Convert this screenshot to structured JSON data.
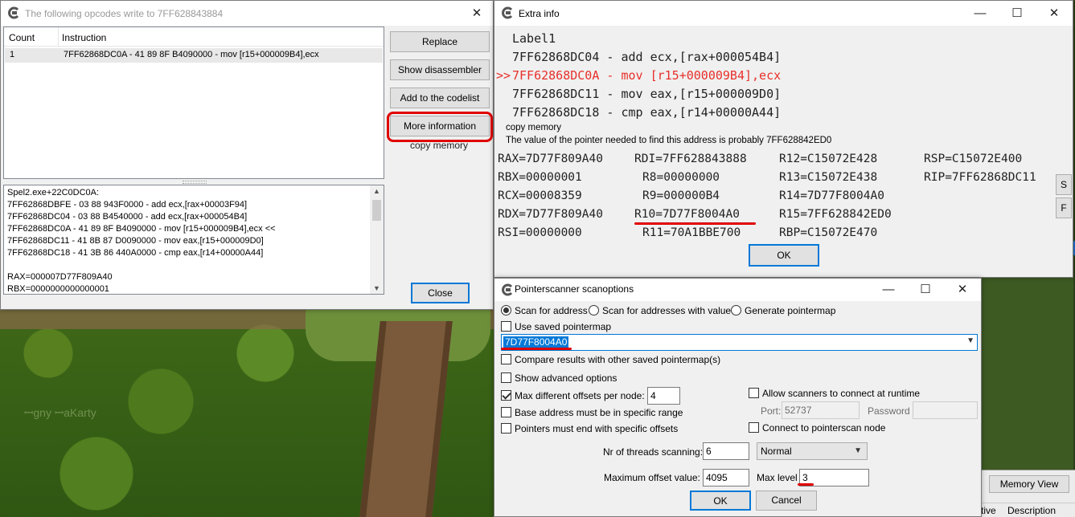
{
  "background": {
    "blur_text": "ꟷgny ꟷaKarty",
    "memory_view_label": "Memory View",
    "columns": [
      "ctive",
      "Description"
    ]
  },
  "opcodes_window": {
    "title": "The following opcodes write to 7FF628843884",
    "columns": [
      "Count",
      "Instruction"
    ],
    "rows": [
      {
        "count": "1",
        "instruction": "7FF62868DC0A - 41 89 8F B4090000  - mov [r15+000009B4],ecx"
      }
    ],
    "buttons": {
      "replace": "Replace",
      "show_disassembler": "Show disassembler",
      "add_codelist": "Add to the codelist",
      "more_information": "More information",
      "close": "Close"
    },
    "copy_memory_label": "copy memory",
    "memo_lines": [
      "Spel2.exe+22C0DC0A:",
      "7FF62868DBFE - 03 88 943F0000  - add ecx,[rax+00003F94]",
      "7FF62868DC04 - 03 88 B4540000  - add ecx,[rax+000054B4]",
      "7FF62868DC0A - 41 89 8F B4090000  - mov [r15+000009B4],ecx <<",
      "7FF62868DC11 - 41 8B 87 D0090000  - mov eax,[r15+000009D0]",
      "7FF62868DC18 - 41 3B 86 440A0000  - cmp eax,[r14+00000A44]",
      "",
      "RAX=000007D77F809A40",
      "RBX=0000000000000001"
    ]
  },
  "extra_info_window": {
    "title": "Extra info",
    "label": "Label1",
    "code_lines": [
      {
        "prefix": "",
        "text": "7FF62868DC04 - add ecx,[rax+000054B4]",
        "current": false
      },
      {
        "prefix": ">>",
        "text": "7FF62868DC0A - mov [r15+000009B4],ecx",
        "current": true
      },
      {
        "prefix": "",
        "text": "7FF62868DC11 - mov eax,[r15+000009D0]",
        "current": false
      },
      {
        "prefix": "",
        "text": "7FF62868DC18 - cmp eax,[r14+00000A44]",
        "current": false
      }
    ],
    "copy_memory": "copy memory",
    "pointer_note": "The value of the pointer needed to find this address is probably 7FF628842ED0",
    "registers": [
      [
        "RAX=7D77F809A40",
        "RDI=7FF628843888",
        "R12=C15072E428",
        "RSP=C15072E400"
      ],
      [
        "RBX=00000001",
        "R8=00000000",
        "R13=C15072E438",
        "RIP=7FF62868DC11"
      ],
      [
        "RCX=00008359",
        "R9=000000B4",
        "R14=7D77F8004A0",
        ""
      ],
      [
        "RDX=7D77F809A40",
        "R10=7D77F8004A0",
        "R15=7FF628842ED0",
        ""
      ],
      [
        "RSI=00000000",
        "R11=70A1BBE700",
        "RBP=C15072E470",
        ""
      ]
    ],
    "side_buttons": [
      "S",
      "F"
    ],
    "ok": "OK"
  },
  "pointerscan_window": {
    "title": "Pointerscanner scanoptions",
    "radios": [
      "Scan for address",
      "Scan for addresses with value",
      "Generate pointermap"
    ],
    "use_saved_pointermap": "Use saved pointermap",
    "address_value": "7D77F8004A0",
    "compare_results": "Compare results with other saved pointermap(s)",
    "show_advanced": "Show advanced options",
    "max_offsets_label": "Max different offsets per node:",
    "max_offsets_value": "4",
    "base_address_range": "Base address must be in specific range",
    "pointers_end_offsets": "Pointers must end with specific offsets",
    "allow_scanners": "Allow scanners to connect at runtime",
    "port_label": "Port:",
    "port_value": "52737",
    "password_label": "Password",
    "connect_node": "Connect to pointerscan node",
    "threads_label": "Nr of threads scanning:",
    "threads_value": "6",
    "priority_value": "Normal",
    "max_offset_label": "Maximum offset value:",
    "max_offset_value": "4095",
    "max_level_label": "Max level",
    "max_level_value": "3",
    "ok": "OK",
    "cancel": "Cancel"
  }
}
